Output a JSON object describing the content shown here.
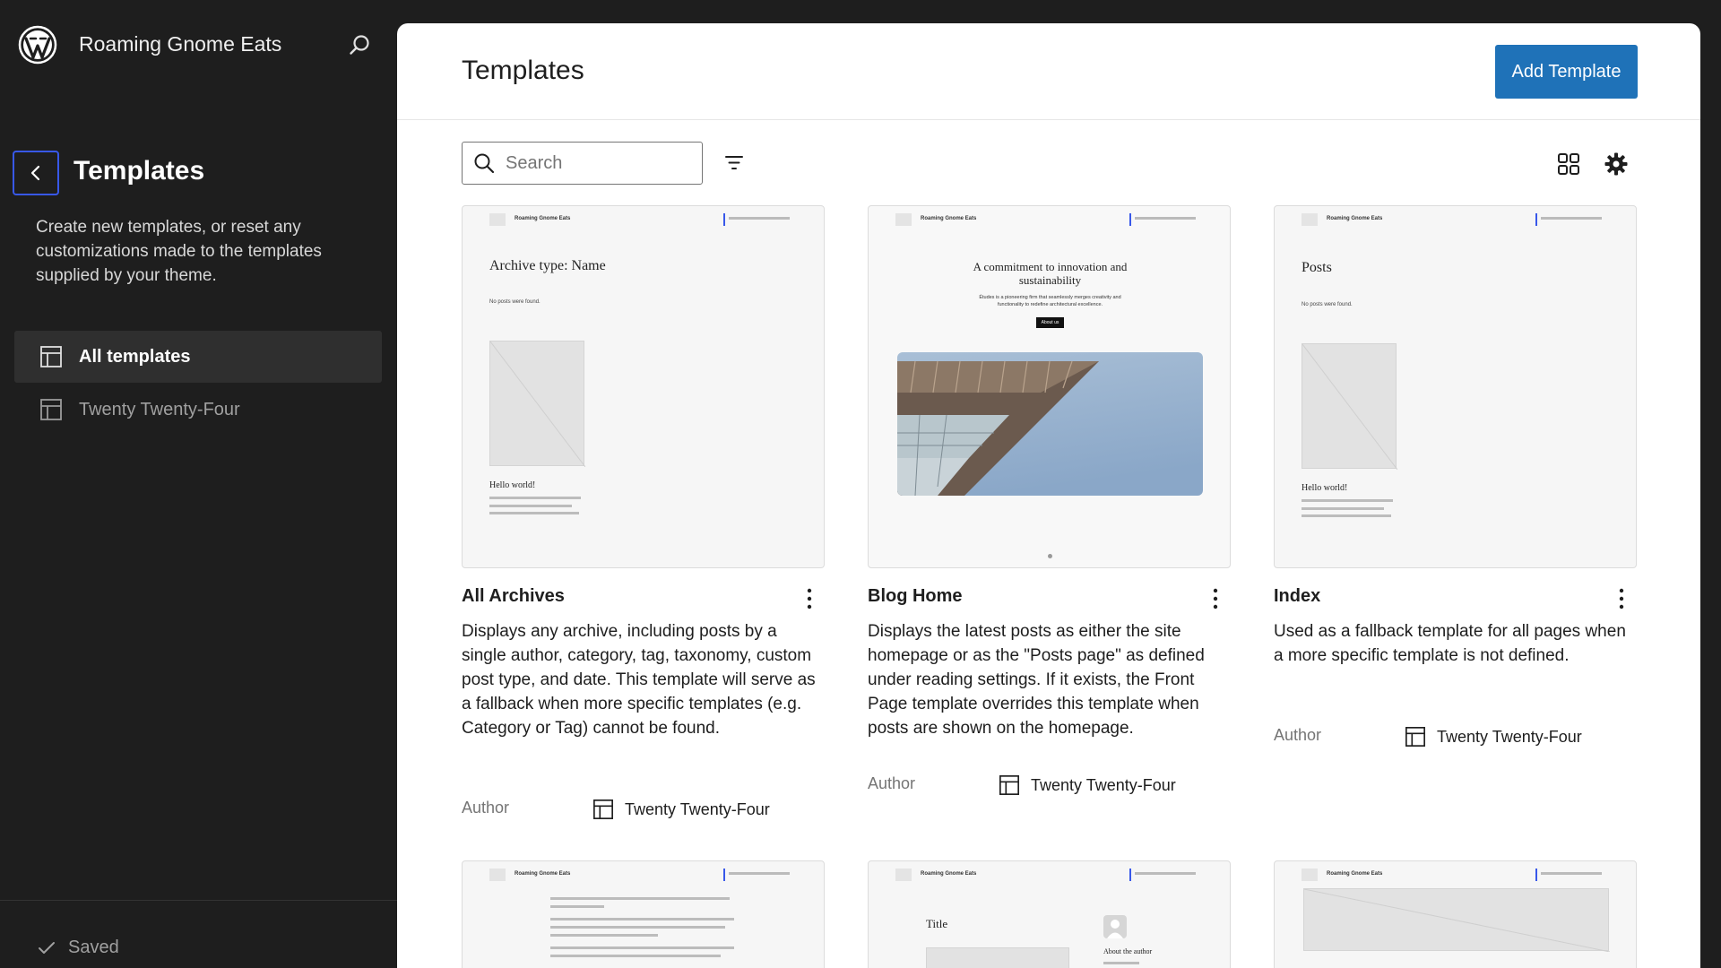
{
  "site": {
    "title": "Roaming Gnome Eats"
  },
  "sidebar": {
    "heading": "Templates",
    "description": "Create new templates, or reset any customizations made to the templates supplied by your theme.",
    "nav": [
      {
        "label": "All templates",
        "active": true
      },
      {
        "label": "Twenty Twenty-Four",
        "active": false
      }
    ],
    "status": "Saved"
  },
  "header": {
    "title": "Templates",
    "add_button": "Add Template"
  },
  "toolbar": {
    "search_placeholder": "Search"
  },
  "preview": {
    "site_name": "Roaming Gnome Eats",
    "archive_heading": "Archive type: Name",
    "no_posts": "No posts were found.",
    "hello": "Hello world!",
    "blog_heading": "A commitment to innovation and sustainability",
    "blog_sub": "Études is a pioneering firm that seamlessly merges creativity and functionality to redefine architectural excellence.",
    "blog_btn": "About us",
    "posts_heading": "Posts",
    "title_label": "Title",
    "about_author": "About the author"
  },
  "templates": [
    {
      "name": "All Archives",
      "description": "Displays any archive, including posts by a single author, category, tag, taxonomy, custom post type, and date. This template will serve as a fallback when more specific templates (e.g. Category or Tag) cannot be found.",
      "author_label": "Author",
      "theme": "Twenty Twenty-Four"
    },
    {
      "name": "Blog Home",
      "description": "Displays the latest posts as either the site homepage or as the \"Posts page\" as defined under reading settings. If it exists, the Front Page template overrides this template when posts are shown on the homepage.",
      "author_label": "Author",
      "theme": "Twenty Twenty-Four"
    },
    {
      "name": "Index",
      "description": "Used as a fallback template for all pages when a more specific template is not defined.",
      "author_label": "Author",
      "theme": "Twenty Twenty-Four"
    }
  ],
  "colors": {
    "accent": "#3858e9",
    "button": "#1f72b8",
    "sidebar_bg": "#1e1e1e"
  },
  "icons": {
    "logo": "wordpress-logo-icon",
    "search": "search-icon",
    "back": "chevron-left-icon",
    "layout": "layout-icon",
    "filter": "filter-icon",
    "grid": "grid-view-icon",
    "settings": "gear-icon",
    "more": "more-vertical-icon",
    "check": "check-icon"
  }
}
